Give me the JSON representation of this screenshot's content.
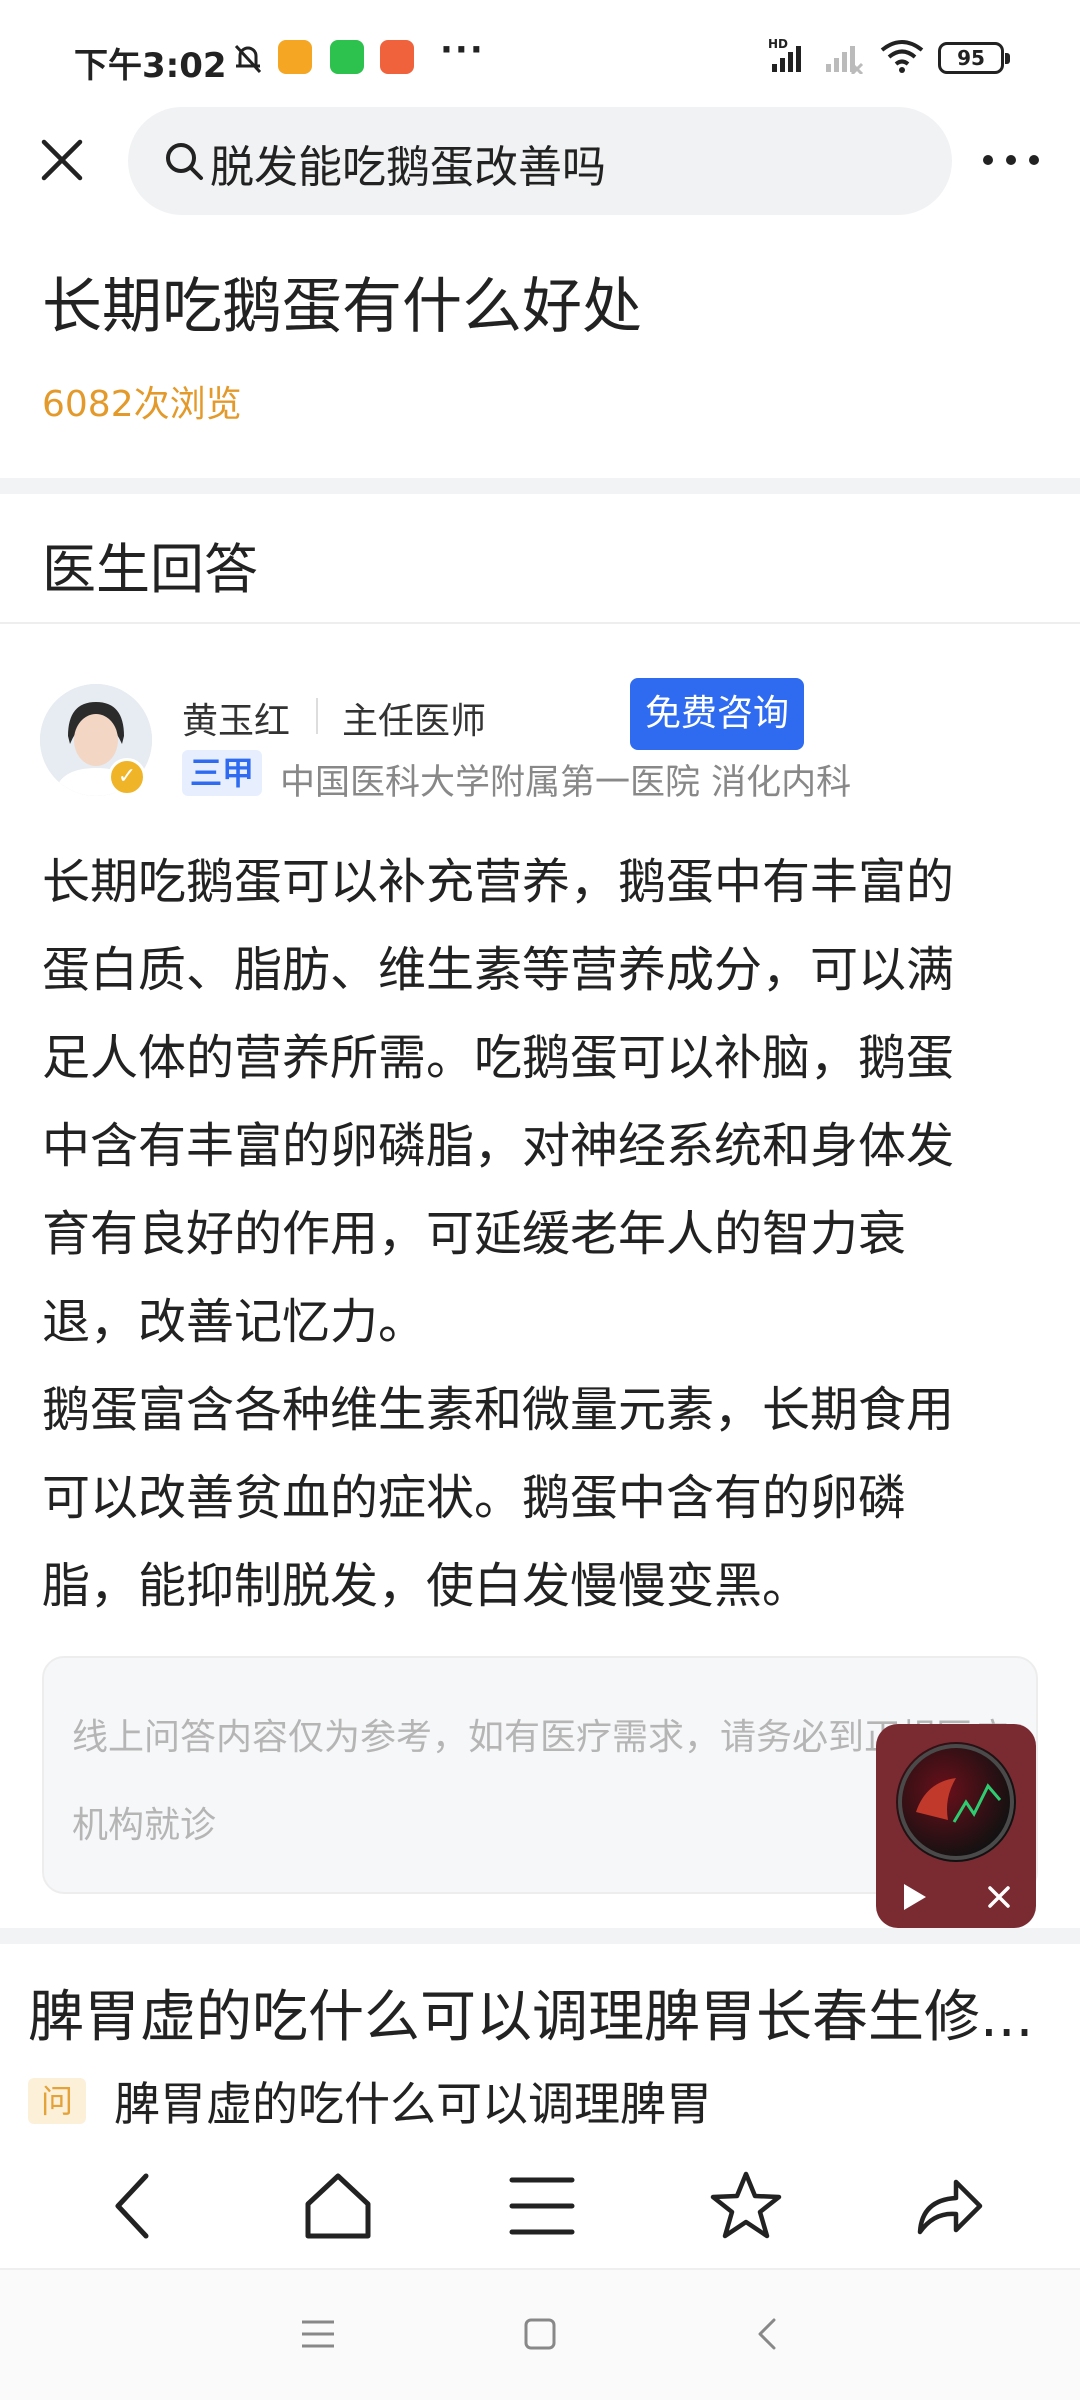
{
  "status_bar": {
    "time": "下午3:02",
    "battery": "95",
    "icons": [
      "mute-bell-icon",
      "app-notification-icon",
      "wechat-icon",
      "app-notification-icon",
      "more-dots-icon",
      "hd-signal-icon",
      "signal-icon",
      "wifi-icon",
      "battery-icon"
    ]
  },
  "search": {
    "query": "脱发能吃鹅蛋改善吗"
  },
  "question": {
    "title": "长期吃鹅蛋有什么好处",
    "views": "6082次浏览"
  },
  "section": {
    "title": "医生回答"
  },
  "doctor": {
    "name": "黄玉红",
    "title": "主任医师",
    "consult_label": "免费咨询",
    "grade": "三甲",
    "hospital": "中国医科大学附属第一医院 消化内科"
  },
  "answer": {
    "paragraph_1": "长期吃鹅蛋可以补充营养，鹅蛋中有丰富的\n蛋白质、脂肪、维生素等营养成分，可以满\n足人体的营养所需。吃鹅蛋可以补脑，鹅蛋\n中含有丰富的卵磷脂，对神经系统和身体发\n育有良好的作用，可延缓老年人的智力衰\n退，改善记忆力。",
    "paragraph_2": "鹅蛋富含各种维生素和微量元素，长期食用\n可以改善贫血的症状。鹅蛋中含有的卵磷\n脂，能抑制脱发，使白发慢慢变黑。"
  },
  "disclaimer": {
    "text": "线上问答内容仅为参考，如有医疗需求，请务必到正规医疗机构就诊"
  },
  "related": {
    "title": "脾胃虚的吃什么可以调理脾胃长春生修...",
    "badge": "问",
    "subtitle": "脾胃虚的吃什么可以调理脾胃"
  },
  "colors": {
    "accent_blue": "#2f6bf1",
    "views_orange": "#e39a2b",
    "player_bg": "#7a2b32"
  }
}
